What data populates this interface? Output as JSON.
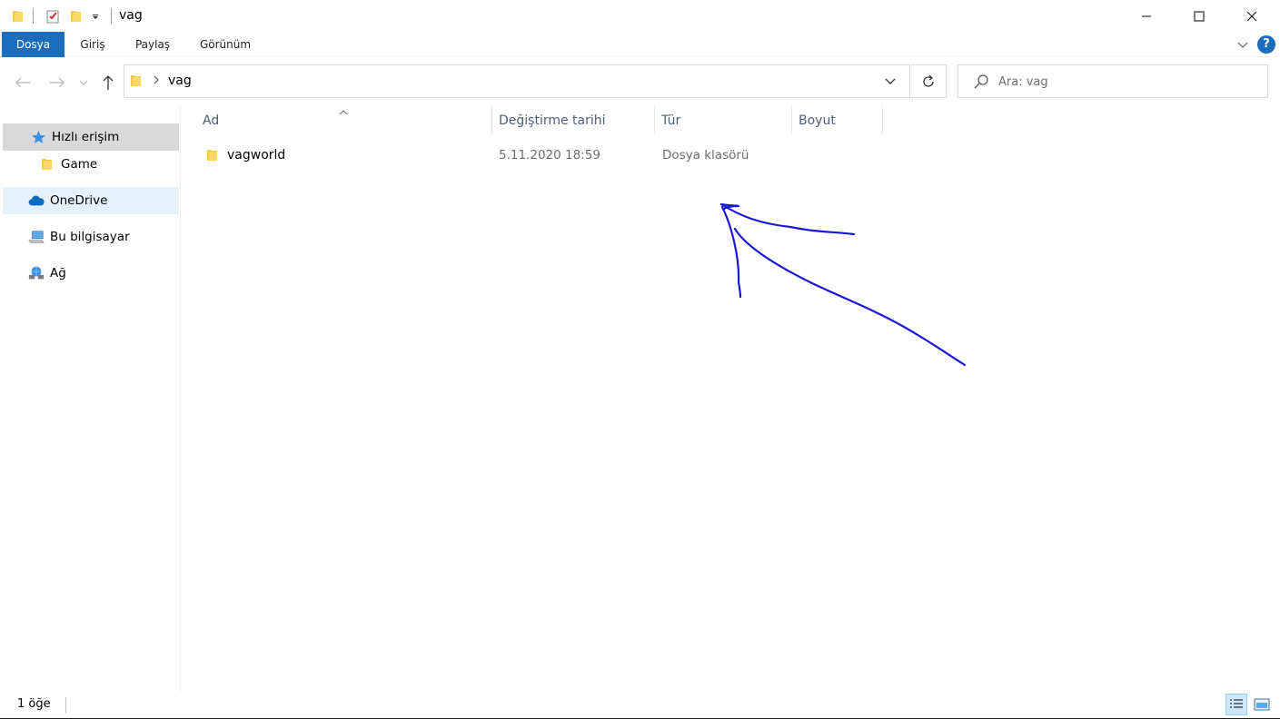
{
  "window": {
    "title": "vag",
    "quick_access_toolbar": [
      "folder-icon",
      "properties-icon",
      "new-folder-icon",
      "customize-dropdown-icon"
    ]
  },
  "ribbon": {
    "tabs": [
      {
        "label": "Dosya",
        "active": true
      },
      {
        "label": "Giriş"
      },
      {
        "label": "Paylaş"
      },
      {
        "label": "Görünüm"
      }
    ],
    "help_label": "?"
  },
  "address_bar": {
    "path": "vag"
  },
  "search": {
    "placeholder": "Ara: vag"
  },
  "sidebar": {
    "items": [
      {
        "label": "Hızlı erişim",
        "icon": "star-icon",
        "selected": true
      },
      {
        "label": "Game",
        "icon": "folder-icon"
      },
      {
        "label": "OneDrive",
        "icon": "onedrive-cloud-icon"
      },
      {
        "label": "Bu bilgisayar",
        "icon": "computer-icon"
      },
      {
        "label": "Ağ",
        "icon": "network-icon"
      }
    ]
  },
  "file_list": {
    "columns": [
      "Ad",
      "Değiştirme tarihi",
      "Tür",
      "Boyut"
    ],
    "rows": [
      {
        "name": "vagworld",
        "modified": "5.11.2020 18:59",
        "type": "Dosya klasörü",
        "size": ""
      }
    ]
  },
  "status_bar": {
    "item_count": "1 öğe"
  },
  "colors": {
    "accent": "#1a6ebd",
    "annotation": "#1a18d6",
    "folder": "#f5c84c"
  }
}
